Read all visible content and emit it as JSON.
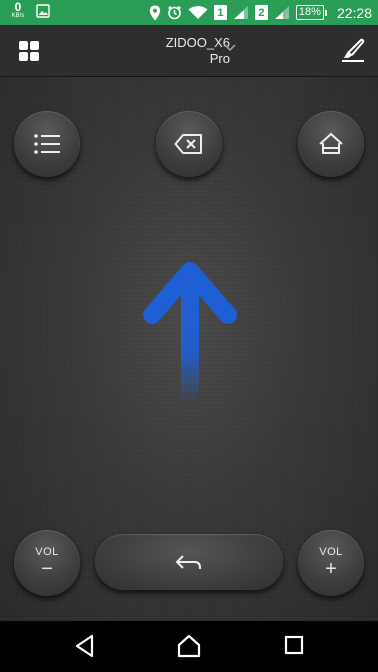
{
  "status_bar": {
    "speed_value": "0",
    "speed_unit": "KB/s",
    "sim1": "1",
    "sim2": "2",
    "battery": "18%",
    "time": "22:28",
    "color": "#2a9d57"
  },
  "app_bar": {
    "device_line1": "ZIDOO_X6",
    "device_line2": "Pro"
  },
  "remote": {
    "menu_icon": "list-icon",
    "delete_icon": "backspace-icon",
    "home_icon": "home-icon",
    "gesture": "swipe-up-arrow",
    "arrow_color": "#1f5fd6",
    "vol_down_label": "VOL",
    "vol_down_sign": "−",
    "vol_up_label": "VOL",
    "vol_up_sign": "+",
    "back_icon": "return-arrow-icon"
  },
  "nav_bar": {
    "back": "triangle-back-icon",
    "home": "home-outline-icon",
    "recents": "square-recents-icon"
  }
}
